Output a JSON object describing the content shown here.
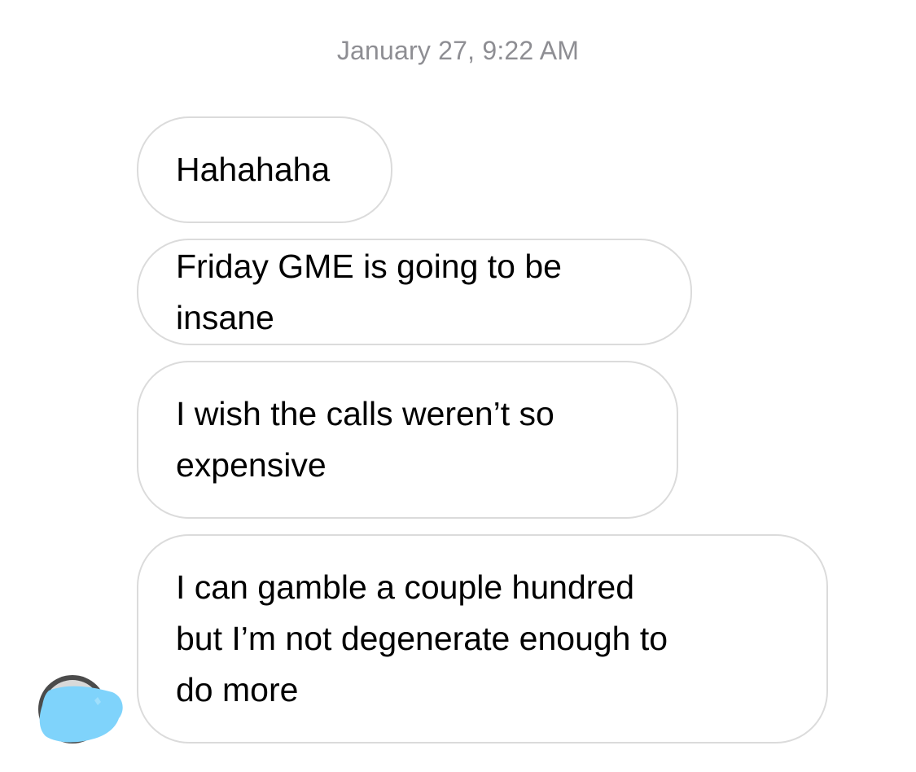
{
  "timestamp": "January 27, 9:22 AM",
  "messages": [
    {
      "text": "Hahahaha"
    },
    {
      "text": "Friday GME is going to be insane"
    },
    {
      "text": "I wish the calls weren’t so\nexpensive"
    },
    {
      "text": "I can gamble a couple hundred\nbut I’m not degenerate enough to\ndo more"
    }
  ],
  "colors": {
    "timestamp": "#8e8e93",
    "bubble_border": "#dbdbdb",
    "bubble_text": "#000000",
    "redaction": "#7fd3fb"
  },
  "avatar": {
    "icon": "avatar-icon"
  }
}
